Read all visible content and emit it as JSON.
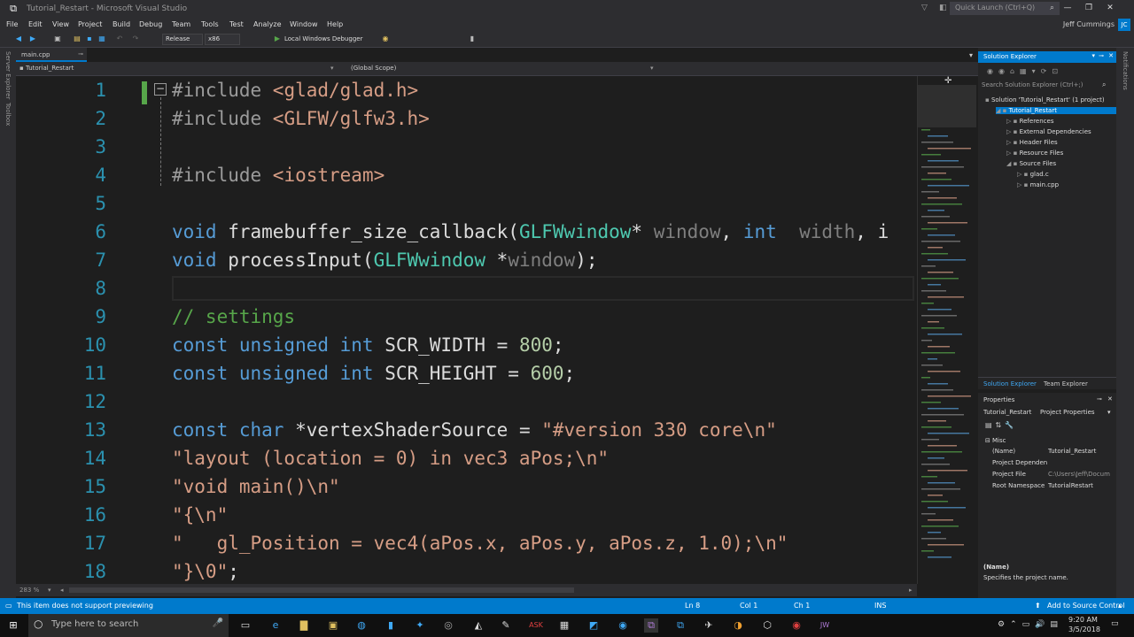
{
  "window": {
    "title": "Tutorial_Restart - Microsoft Visual Studio",
    "quick_launch": "Quick Launch (Ctrl+Q)",
    "user": "Jeff Cummings",
    "user_initials": "JC"
  },
  "menu": [
    "File",
    "Edit",
    "View",
    "Project",
    "Build",
    "Debug",
    "Team",
    "Tools",
    "Test",
    "Analyze",
    "Window",
    "Help"
  ],
  "toolbar": {
    "config": "Release",
    "platform": "x86",
    "run_label": "Local Windows Debugger"
  },
  "side_labels": {
    "server_explorer": "Server Explorer",
    "toolbox": "Toolbox",
    "notifications": "Notifications"
  },
  "doc_tab": "main.cpp",
  "navbar": {
    "project": "Tutorial_Restart",
    "scope": "(Global Scope)"
  },
  "code_lines": [
    {
      "n": "1",
      "tokens": [
        [
          "pp",
          "#include "
        ],
        [
          "str",
          "<glad/glad.h>"
        ]
      ]
    },
    {
      "n": "2",
      "tokens": [
        [
          "pp",
          "#include "
        ],
        [
          "str",
          "<GLFW/glfw3.h>"
        ]
      ]
    },
    {
      "n": "3",
      "tokens": []
    },
    {
      "n": "4",
      "tokens": [
        [
          "pp",
          "#include "
        ],
        [
          "str",
          "<iostream>"
        ]
      ]
    },
    {
      "n": "5",
      "tokens": []
    },
    {
      "n": "6",
      "tokens": [
        [
          "kw",
          "void"
        ],
        [
          "",
          "framebuffer_size_callback("
        ],
        [
          "ty",
          "GLFWwindow"
        ],
        [
          "",
          "* "
        ],
        [
          "par",
          "window"
        ],
        [
          "",
          ", "
        ],
        [
          "kw",
          "int"
        ],
        [
          "",
          ""
        ],
        [
          "par",
          " width"
        ],
        [
          "",
          ", i"
        ]
      ]
    },
    {
      "n": "7",
      "tokens": [
        [
          "kw",
          "void"
        ],
        [
          "",
          " processInput("
        ],
        [
          "ty",
          "GLFWwindow"
        ],
        [
          "",
          " *"
        ],
        [
          "par",
          "window"
        ],
        [
          "",
          ");"
        ]
      ]
    },
    {
      "n": "8",
      "tokens": []
    },
    {
      "n": "9",
      "tokens": [
        [
          "cm",
          "// settings"
        ]
      ]
    },
    {
      "n": "10",
      "tokens": [
        [
          "kw",
          "const unsigned int"
        ],
        [
          "",
          " SCR_WIDTH = "
        ],
        [
          "num",
          "800"
        ],
        [
          "",
          ";"
        ]
      ]
    },
    {
      "n": "11",
      "tokens": [
        [
          "kw",
          "const unsigned int"
        ],
        [
          "",
          " SCR_HEIGHT = "
        ],
        [
          "num",
          "600"
        ],
        [
          "",
          ";"
        ]
      ]
    },
    {
      "n": "12",
      "tokens": []
    },
    {
      "n": "13",
      "tokens": [
        [
          "kw",
          "const char"
        ],
        [
          "",
          " *vertexShaderSource = "
        ],
        [
          "str",
          "\"#version 330 core\\n\""
        ]
      ]
    },
    {
      "n": "14",
      "tokens": [
        [
          "str",
          "\"layout (location = 0) in vec3 aPos;\\n\""
        ]
      ]
    },
    {
      "n": "15",
      "tokens": [
        [
          "str",
          "\"void main()\\n\""
        ]
      ]
    },
    {
      "n": "16",
      "tokens": [
        [
          "str",
          "\"{\\n\""
        ]
      ]
    },
    {
      "n": "17",
      "tokens": [
        [
          "str",
          "\"   gl_Position = vec4(aPos.x, aPos.y, aPos.z, 1.0);\\n\""
        ]
      ]
    },
    {
      "n": "18",
      "tokens": [
        [
          "str",
          "\"}\\0\""
        ],
        [
          "",
          ";"
        ]
      ]
    }
  ],
  "zoom": "283 %",
  "solution_explorer": {
    "title": "Solution Explorer",
    "search_placeholder": "Search Solution Explorer (Ctrl+;)",
    "items": [
      {
        "label": "Solution 'Tutorial_Restart' (1 project)",
        "level": 0,
        "selected": false
      },
      {
        "label": "Tutorial_Restart",
        "level": 1,
        "selected": true
      },
      {
        "label": "References",
        "level": 2,
        "selected": false
      },
      {
        "label": "External Dependencies",
        "level": 2,
        "selected": false
      },
      {
        "label": "Header Files",
        "level": 2,
        "selected": false
      },
      {
        "label": "Resource Files",
        "level": 2,
        "selected": false
      },
      {
        "label": "Source Files",
        "level": 2,
        "selected": false
      },
      {
        "label": "glad.c",
        "level": 3,
        "selected": false
      },
      {
        "label": "main.cpp",
        "level": 3,
        "selected": false
      }
    ],
    "tabs": [
      "Solution Explorer",
      "Team Explorer"
    ]
  },
  "properties": {
    "title": "Properties",
    "object": "Tutorial_Restart",
    "object_type": "Project Properties",
    "category": "Misc",
    "rows": [
      {
        "name": "(Name)",
        "value": "Tutorial_Restart"
      },
      {
        "name": "Project Dependen",
        "value": ""
      },
      {
        "name": "Project File",
        "value": "C:\\Users\\Jeff\\Docum"
      },
      {
        "name": "Root Namespace",
        "value": "TutorialRestart"
      }
    ],
    "desc_title": "(Name)",
    "desc_text": "Specifies the project name."
  },
  "status": {
    "message": "This item does not support previewing",
    "ln": "Ln 8",
    "col": "Col 1",
    "ch": "Ch 1",
    "ins": "INS",
    "source_control": "Add to Source Control"
  },
  "taskbar": {
    "search": "Type here to search",
    "time": "9:20 AM",
    "date": "3/5/2018"
  }
}
